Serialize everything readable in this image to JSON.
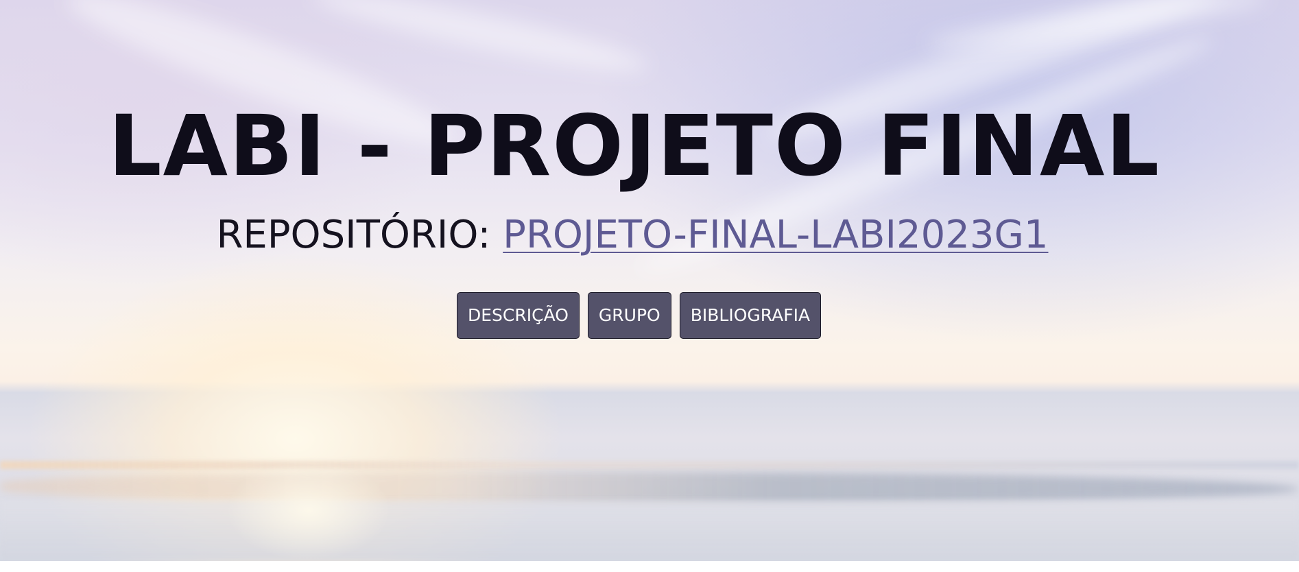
{
  "header": {
    "title": "LABI - PROJETO FINAL",
    "repo_label": "REPOSITÓRIO: ",
    "repo_link_text": "PROJETO-FINAL-LABI2023G1"
  },
  "nav": {
    "buttons": [
      {
        "label": "DESCRIÇÃO"
      },
      {
        "label": "GRUPO"
      },
      {
        "label": "BIBLIOGRAFIA"
      }
    ]
  },
  "colors": {
    "title": "#0f0d1a",
    "link": "#5e5a93",
    "button_bg": "#54526a",
    "button_text": "#ffffff"
  }
}
